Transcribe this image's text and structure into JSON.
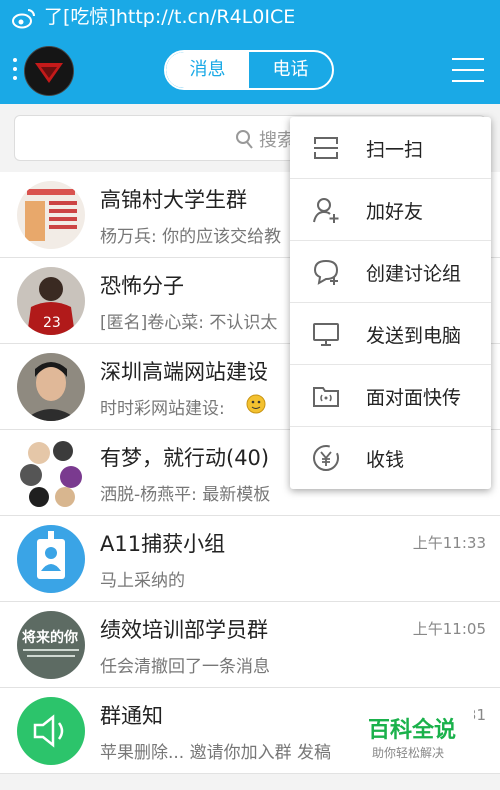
{
  "status_bar": {
    "notification_text": "了[吃惊]http://t.cn/R4L0ICE",
    "icon": "weibo-icon"
  },
  "top_bar": {
    "tabs": [
      {
        "label": "消息",
        "selected": true
      },
      {
        "label": "电话",
        "selected": false
      }
    ],
    "menu_icon": "hamburger-menu-icon",
    "accent_color": "#1aa9e6"
  },
  "search": {
    "placeholder": "搜索",
    "icon": "search-icon"
  },
  "conversations": [
    {
      "name": "高锦村大学生群",
      "message": "杨万兵: 你的应该交给教",
      "time": ""
    },
    {
      "name": "恐怖分子",
      "message": "[匿名]卷心菜: 不认识太",
      "time": ""
    },
    {
      "name": "深圳高端网站建设",
      "message": "时时彩网站建设:",
      "time": ""
    },
    {
      "name": "有梦，就行动(40)",
      "message": "洒脱-杨燕平: 最新模板",
      "time": ""
    },
    {
      "name": "A11捕获小组",
      "message": "马上采纳的",
      "time": "上午11:33"
    },
    {
      "name": "绩效培训部学员群",
      "message": "任会清撤回了一条消息",
      "time": "上午11:05",
      "avatar_text": "将来的你"
    },
    {
      "name": "群通知",
      "message": "苹果删除... 邀请你加入群 发稿",
      "time": "上午11:31"
    }
  ],
  "popup_menu": [
    {
      "label": "扫一扫",
      "icon": "scan-icon"
    },
    {
      "label": "加好友",
      "icon": "add-friend-icon"
    },
    {
      "label": "创建讨论组",
      "icon": "create-discussion-icon"
    },
    {
      "label": "发送到电脑",
      "icon": "computer-icon"
    },
    {
      "label": "面对面快传",
      "icon": "face-to-face-transfer-icon"
    },
    {
      "label": "收钱",
      "icon": "receive-money-icon"
    }
  ],
  "watermark": {
    "title": "百科全说",
    "subtitle": "助你轻松解决"
  }
}
